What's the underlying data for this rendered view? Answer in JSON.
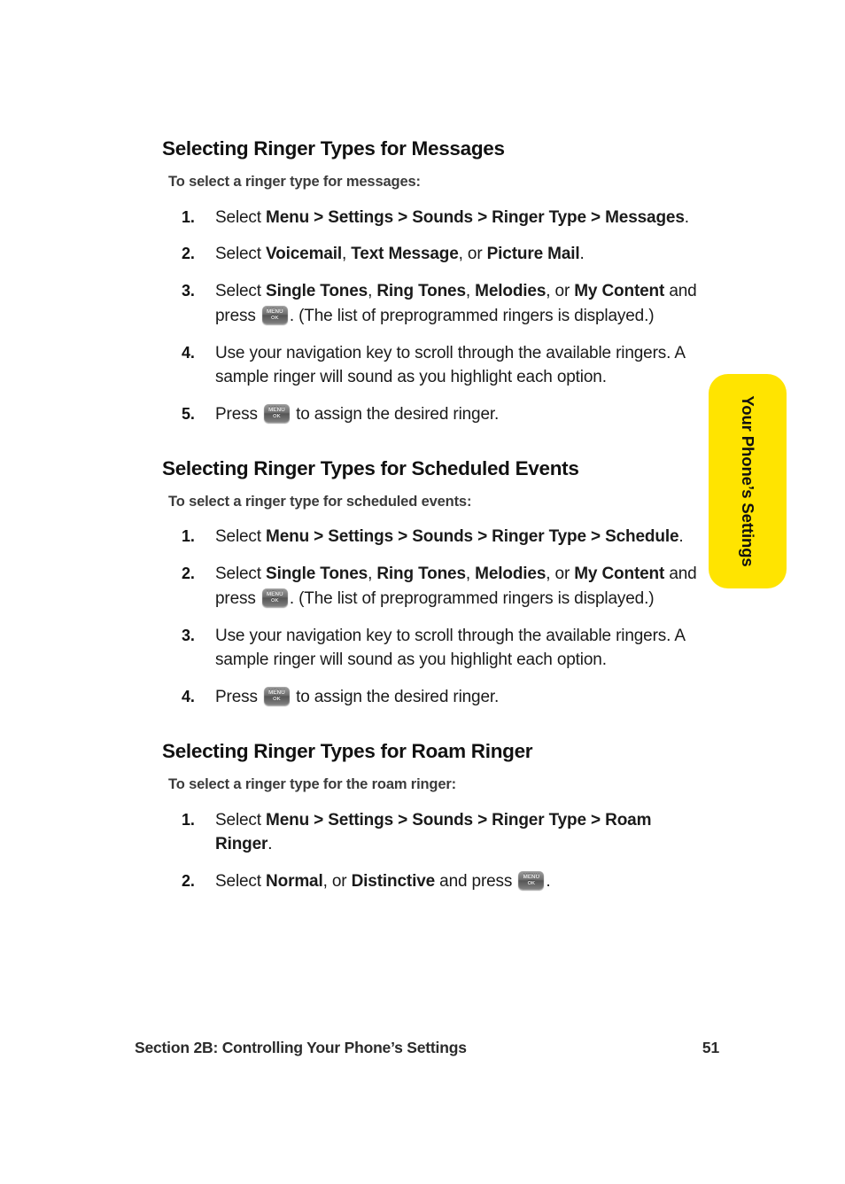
{
  "page": {
    "number": "51",
    "footer_section": "Section 2B: Controlling Your Phone’s Settings"
  },
  "side_tab": {
    "label": "Your Phone’s Settings",
    "color": "#ffe400",
    "text_color": "#111111"
  },
  "icons": {
    "menu_ok_key": {
      "name": "menu-ok-key-icon",
      "line1": "MENU",
      "line2": "OK"
    }
  },
  "sections": [
    {
      "heading": "Selecting Ringer Types for Messages",
      "intro": "To select a ringer type for messages:",
      "steps": [
        {
          "number": "1.",
          "parts": [
            {
              "text": "Select ",
              "bold": false
            },
            {
              "text": "Menu > Settings > Sounds > Ringer Type > Messages",
              "bold": true
            },
            {
              "text": ".",
              "bold": false
            }
          ]
        },
        {
          "number": "2.",
          "parts": [
            {
              "text": "Select ",
              "bold": false
            },
            {
              "text": "Voicemail",
              "bold": true
            },
            {
              "text": ", ",
              "bold": false
            },
            {
              "text": "Text Message",
              "bold": true
            },
            {
              "text": ", or ",
              "bold": false
            },
            {
              "text": "Picture Mail",
              "bold": true
            },
            {
              "text": ".",
              "bold": false
            }
          ]
        },
        {
          "number": "3.",
          "parts": [
            {
              "text": "Select ",
              "bold": false
            },
            {
              "text": "Single Tones",
              "bold": true
            },
            {
              "text": ", ",
              "bold": false
            },
            {
              "text": "Ring Tones",
              "bold": true
            },
            {
              "text": ", ",
              "bold": false
            },
            {
              "text": "Melodies",
              "bold": true
            },
            {
              "text": ", or ",
              "bold": false
            },
            {
              "text": "My Content",
              "bold": true
            },
            {
              "text": " and press ",
              "bold": false
            },
            {
              "icon": "menu-ok-key-icon"
            },
            {
              "text": ". (The list of preprogrammed ringers is displayed.)",
              "bold": false
            }
          ]
        },
        {
          "number": "4.",
          "parts": [
            {
              "text": "Use your navigation key to scroll through the available ringers. A sample ringer will sound as you highlight each option.",
              "bold": false
            }
          ]
        },
        {
          "number": "5.",
          "parts": [
            {
              "text": "Press ",
              "bold": false
            },
            {
              "icon": "menu-ok-key-icon"
            },
            {
              "text": " to assign the desired ringer.",
              "bold": false
            }
          ]
        }
      ]
    },
    {
      "heading": "Selecting Ringer Types for Scheduled Events",
      "intro": "To select a ringer type for scheduled events:",
      "steps": [
        {
          "number": "1.",
          "parts": [
            {
              "text": "Select ",
              "bold": false
            },
            {
              "text": "Menu > Settings > Sounds > Ringer Type > Schedule",
              "bold": true
            },
            {
              "text": ".",
              "bold": false
            }
          ]
        },
        {
          "number": "2.",
          "parts": [
            {
              "text": "Select ",
              "bold": false
            },
            {
              "text": "Single Tones",
              "bold": true
            },
            {
              "text": ", ",
              "bold": false
            },
            {
              "text": "Ring Tones",
              "bold": true
            },
            {
              "text": ", ",
              "bold": false
            },
            {
              "text": "Melodies",
              "bold": true
            },
            {
              "text": ", or ",
              "bold": false
            },
            {
              "text": "My Content",
              "bold": true
            },
            {
              "text": " and press ",
              "bold": false
            },
            {
              "icon": "menu-ok-key-icon"
            },
            {
              "text": ". (The list of preprogrammed ringers is displayed.)",
              "bold": false
            }
          ]
        },
        {
          "number": "3.",
          "parts": [
            {
              "text": "Use your navigation key to scroll through the available ringers. A sample ringer will sound as you highlight each option.",
              "bold": false
            }
          ]
        },
        {
          "number": "4.",
          "parts": [
            {
              "text": "Press ",
              "bold": false
            },
            {
              "icon": "menu-ok-key-icon"
            },
            {
              "text": " to assign the desired ringer.",
              "bold": false
            }
          ]
        }
      ]
    },
    {
      "heading": "Selecting Ringer Types for Roam Ringer",
      "intro": "To select a ringer type for the roam ringer:",
      "steps": [
        {
          "number": "1.",
          "parts": [
            {
              "text": "Select ",
              "bold": false
            },
            {
              "text": "Menu > Settings > Sounds > Ringer Type > Roam Ringer",
              "bold": true
            },
            {
              "text": ".",
              "bold": false
            }
          ]
        },
        {
          "number": "2.",
          "parts": [
            {
              "text": "Select ",
              "bold": false
            },
            {
              "text": "Normal",
              "bold": true
            },
            {
              "text": ", or ",
              "bold": false
            },
            {
              "text": "Distinctive",
              "bold": true
            },
            {
              "text": " and press ",
              "bold": false
            },
            {
              "icon": "menu-ok-key-icon"
            },
            {
              "text": ".",
              "bold": false
            }
          ]
        }
      ]
    }
  ]
}
